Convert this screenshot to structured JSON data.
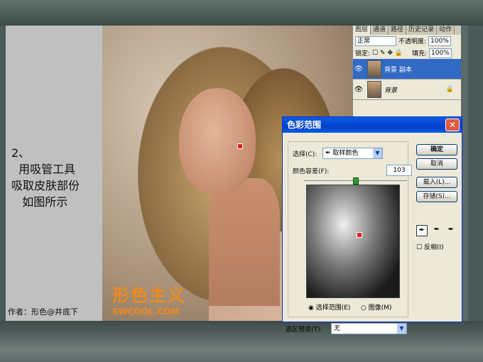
{
  "slide": {
    "caption": "2、\n  用吸管工具\n吸取皮肤部份\n   如图所示",
    "author": "作者：形色@井底下"
  },
  "logo": {
    "main": "形色主义",
    "sub": "SWCOOL.COM"
  },
  "layers_panel": {
    "tabs": [
      "图层",
      "通道",
      "路径",
      "历史记录",
      "动作"
    ],
    "blend_mode": "正常",
    "opacity_label": "不透明度:",
    "opacity_value": "100%",
    "lock_label": "锁定:",
    "fill_label": "填充:",
    "fill_value": "100%",
    "layers": [
      {
        "name": "背景 副本",
        "selected": true
      },
      {
        "name": "背景",
        "selected": false
      }
    ]
  },
  "color_range_dialog": {
    "title": "色彩范围",
    "select_label": "选择(C):",
    "select_value": "取样颜色",
    "fuzziness_label": "颜色容差(F):",
    "fuzziness_value": "103",
    "radio_selection": "选择范围(E)",
    "radio_image": "图像(M)",
    "preview_label": "选区预览(T):",
    "preview_value": "无",
    "buttons": {
      "ok": "确定",
      "cancel": "取消",
      "load": "载入(L)...",
      "save": "存储(S)..."
    },
    "invert_label": "反相(I)"
  },
  "colors": {
    "accent": "#316ac5",
    "title_bar": "#0a5be6",
    "logo": "#f08a1c"
  }
}
